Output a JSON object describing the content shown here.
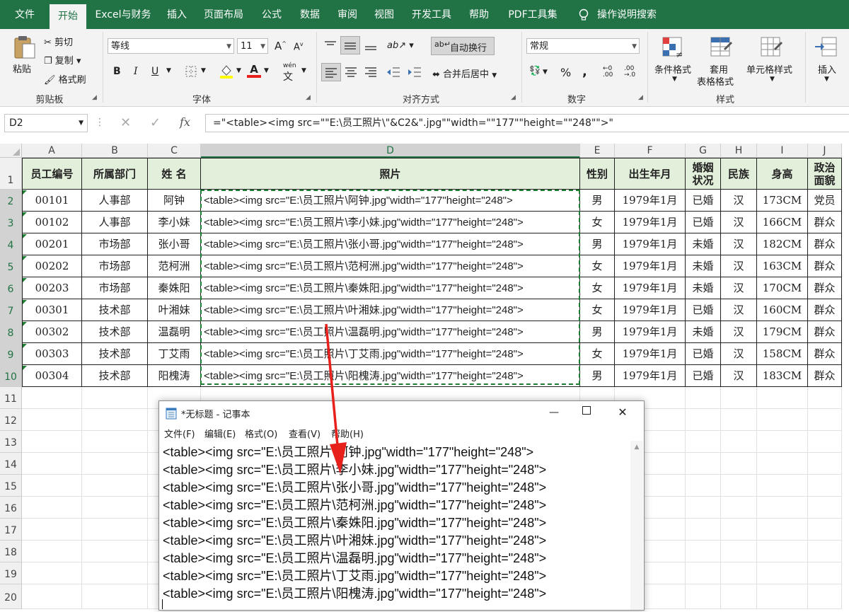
{
  "ribbon_tabs": [
    "文件",
    "开始",
    "Excel与财务",
    "插入",
    "页面布局",
    "公式",
    "数据",
    "审阅",
    "视图",
    "开发工具",
    "帮助",
    "PDF工具集",
    "操作说明搜索"
  ],
  "clipboard": {
    "paste": "粘贴",
    "cut": "剪切",
    "copy": "复制",
    "format_painter": "格式刷",
    "label": "剪贴板"
  },
  "font": {
    "name": "等线",
    "size": "11",
    "label": "字体",
    "bold": "B",
    "italic": "I",
    "underline": "U",
    "grow": "A",
    "shrink": "A",
    "color_letter": "A",
    "wen": "wén"
  },
  "alignment": {
    "wrap": "自动换行",
    "merge": "合并后居中",
    "label": "对齐方式"
  },
  "number": {
    "format": "常规",
    "label": "数字",
    "percent": "%",
    "comma": ","
  },
  "styles": {
    "conditional": "条件格式",
    "table_line1": "套用",
    "table_line2": "表格格式",
    "cell_style": "单元格样式",
    "label": "样式"
  },
  "cells": {
    "insert": "插入"
  },
  "formula_bar": {
    "name_box": "D2",
    "fx": "fx",
    "formula": "=\"<table><img src=\"\"E:\\员工照片\\\"&C2&\".jpg\"\"width=\"\"177\"\"height=\"\"248\"\">\""
  },
  "columns": [
    "A",
    "B",
    "C",
    "D",
    "E",
    "F",
    "G",
    "H",
    "I",
    "J"
  ],
  "rows": [
    "1",
    "2",
    "3",
    "4",
    "5",
    "6",
    "7",
    "8",
    "9",
    "10",
    "11",
    "12",
    "13",
    "14",
    "15",
    "16",
    "17",
    "18",
    "19",
    "20"
  ],
  "headers": [
    "员工编号",
    "所属部门",
    "姓 名",
    "照片",
    "性别",
    "出生年月",
    "婚姻状况",
    "民族",
    "身高",
    "政治面貌"
  ],
  "table_rows": [
    [
      "00101",
      "人事部",
      "阿钟",
      "<table><img src=\"E:\\员工照片\\阿钟.jpg\"width=\"177\"height=\"248\">",
      "男",
      "1979年1月",
      "已婚",
      "汉",
      "173CM",
      "党员"
    ],
    [
      "00102",
      "人事部",
      "李小妹",
      "<table><img src=\"E:\\员工照片\\李小妹.jpg\"width=\"177\"height=\"248\">",
      "女",
      "1979年1月",
      "已婚",
      "汉",
      "166CM",
      "群众"
    ],
    [
      "00201",
      "市场部",
      "张小哥",
      "<table><img src=\"E:\\员工照片\\张小哥.jpg\"width=\"177\"height=\"248\">",
      "男",
      "1979年1月",
      "未婚",
      "汉",
      "182CM",
      "群众"
    ],
    [
      "00202",
      "市场部",
      "范柯洲",
      "<table><img src=\"E:\\员工照片\\范柯洲.jpg\"width=\"177\"height=\"248\">",
      "女",
      "1979年1月",
      "未婚",
      "汉",
      "163CM",
      "群众"
    ],
    [
      "00203",
      "市场部",
      "秦姝阳",
      "<table><img src=\"E:\\员工照片\\秦姝阳.jpg\"width=\"177\"height=\"248\">",
      "女",
      "1979年1月",
      "未婚",
      "汉",
      "170CM",
      "群众"
    ],
    [
      "00301",
      "技术部",
      "叶湘妹",
      "<table><img src=\"E:\\员工照片\\叶湘妹.jpg\"width=\"177\"height=\"248\">",
      "女",
      "1979年1月",
      "已婚",
      "汉",
      "160CM",
      "群众"
    ],
    [
      "00302",
      "技术部",
      "温磊明",
      "<table><img src=\"E:\\员工照片\\温磊明.jpg\"width=\"177\"height=\"248\">",
      "男",
      "1979年1月",
      "未婚",
      "汉",
      "179CM",
      "群众"
    ],
    [
      "00303",
      "技术部",
      "丁艾雨",
      "<table><img src=\"E:\\员工照片\\丁艾雨.jpg\"width=\"177\"height=\"248\">",
      "女",
      "1979年1月",
      "已婚",
      "汉",
      "158CM",
      "群众"
    ],
    [
      "00304",
      "技术部",
      "阳槐涛",
      "<table><img src=\"E:\\员工照片\\阳槐涛.jpg\"width=\"177\"height=\"248\">",
      "男",
      "1979年1月",
      "已婚",
      "汉",
      "183CM",
      "群众"
    ]
  ],
  "notepad": {
    "title": "*无标题 - 记事本",
    "menu": [
      "文件(F)",
      "编辑(E)",
      "格式(O)",
      "查看(V)",
      "帮助(H)"
    ],
    "lines": [
      "<table><img src=\"E:\\员工照片\\阿钟.jpg\"width=\"177\"height=\"248\">",
      "<table><img src=\"E:\\员工照片\\李小妹.jpg\"width=\"177\"height=\"248\">",
      "<table><img src=\"E:\\员工照片\\张小哥.jpg\"width=\"177\"height=\"248\">",
      "<table><img src=\"E:\\员工照片\\范柯洲.jpg\"width=\"177\"height=\"248\">",
      "<table><img src=\"E:\\员工照片\\秦姝阳.jpg\"width=\"177\"height=\"248\">",
      "<table><img src=\"E:\\员工照片\\叶湘妹.jpg\"width=\"177\"height=\"248\">",
      "<table><img src=\"E:\\员工照片\\温磊明.jpg\"width=\"177\"height=\"248\">",
      "<table><img src=\"E:\\员工照片\\丁艾雨.jpg\"width=\"177\"height=\"248\">",
      "<table><img src=\"E:\\员工照片\\阳槐涛.jpg\"width=\"177\"height=\"248\">"
    ]
  },
  "colors": {
    "excel_green": "#217346",
    "header_fill": "#e2efda",
    "arrow": "#e8201c",
    "selection_dash": "#1e7e34"
  }
}
